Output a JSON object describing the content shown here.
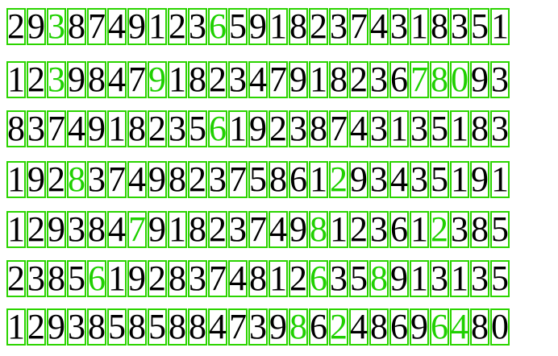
{
  "colors": {
    "box": "#2bd400",
    "digit": "#000000",
    "highlight": "#1fd000",
    "background": "#ffffff"
  },
  "rows": [
    {
      "digits": "29387491236591823743 18351",
      "green": [
        2,
        10
      ]
    },
    {
      "digits": "12398479182347918236780 93",
      "green": [
        2,
        7,
        20,
        21,
        22
      ]
    },
    {
      "digits": "83749182356192387431351 83",
      "green": [
        10
      ]
    },
    {
      "digits": "19283749823758612934351 91",
      "green": [
        3,
        16
      ]
    },
    {
      "digits": "12938479182374981236123 85",
      "green": [
        6,
        15,
        21
      ]
    },
    {
      "digits": "23856192837481263589131 35",
      "green": [
        4,
        15,
        18
      ]
    },
    {
      "digits": "12938585884739862486964 80",
      "green": [
        14,
        16,
        21,
        22,
        26
      ]
    }
  ]
}
